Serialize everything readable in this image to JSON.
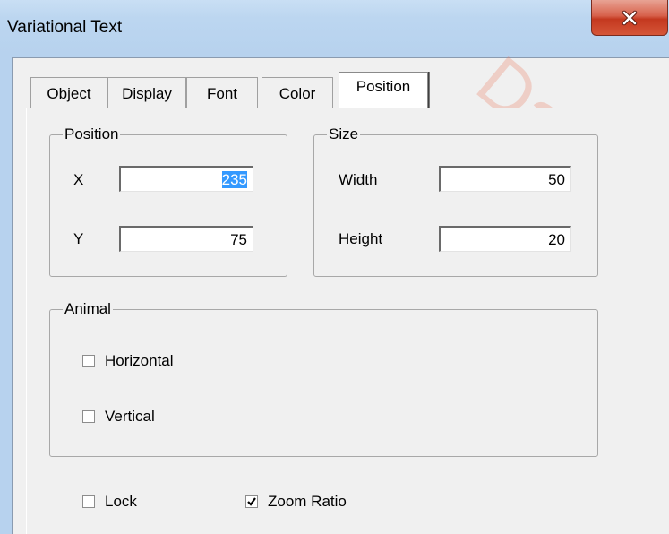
{
  "window": {
    "title": "Variational Text",
    "watermark": "Datoe"
  },
  "tabs": [
    {
      "label": "Object",
      "active": false
    },
    {
      "label": "Display",
      "active": false
    },
    {
      "label": "Font",
      "active": false
    },
    {
      "label": "Color",
      "active": false
    },
    {
      "label": "Position",
      "active": true
    }
  ],
  "position_group": {
    "legend": "Position",
    "x_label": "X",
    "x_value": "235",
    "y_label": "Y",
    "y_value": "75"
  },
  "size_group": {
    "legend": "Size",
    "width_label": "Width",
    "width_value": "50",
    "height_label": "Height",
    "height_value": "20"
  },
  "animal_group": {
    "legend": "Animal",
    "horizontal": {
      "label": "Horizontal",
      "checked": false
    },
    "vertical": {
      "label": "Vertical",
      "checked": false
    }
  },
  "options": {
    "lock": {
      "label": "Lock",
      "checked": false
    },
    "zoom_ratio": {
      "label": "Zoom Ratio",
      "checked": true
    }
  },
  "colors": {
    "titlebar": "#b7d2ee",
    "close_button": "#c4381f",
    "selection": "#3399ff"
  }
}
